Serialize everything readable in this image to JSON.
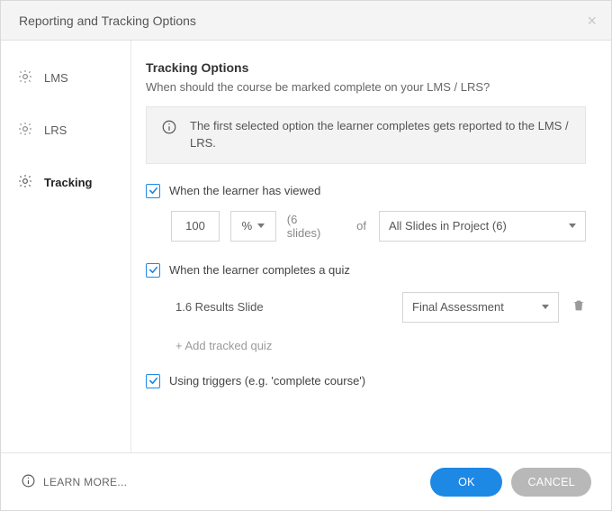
{
  "titlebar": {
    "title": "Reporting and Tracking Options"
  },
  "sidebar": {
    "items": [
      {
        "label": "LMS"
      },
      {
        "label": "LRS"
      },
      {
        "label": "Tracking"
      }
    ]
  },
  "section": {
    "title": "Tracking Options",
    "subtitle": "When should the course be marked complete on your LMS / LRS?"
  },
  "info": {
    "text": "The first selected option the learner completes gets reported to the LMS / LRS."
  },
  "options": {
    "viewed": {
      "label": "When the learner has viewed",
      "value": "100",
      "unit": "%",
      "count_label": "(6 slides)",
      "of_label": "of",
      "scope": "All Slides in Project (6)"
    },
    "quiz": {
      "label": "When the learner completes a quiz",
      "item_label": "1.6 Results Slide",
      "select_value": "Final Assessment",
      "add_label": "+ Add tracked quiz"
    },
    "triggers": {
      "label": "Using triggers (e.g. 'complete course')"
    }
  },
  "footer": {
    "learn_more": "LEARN MORE...",
    "ok": "OK",
    "cancel": "CANCEL"
  }
}
